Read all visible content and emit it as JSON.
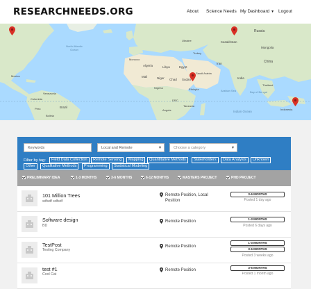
{
  "header": {
    "logo": "RESEARCHNEEDS.ORG",
    "nav": [
      {
        "label": "About"
      },
      {
        "label": "Science Needs"
      },
      {
        "label": "My Dashboard"
      },
      {
        "label": "Logout"
      }
    ]
  },
  "map": {
    "labels": {
      "north_atlantic": "North Atlantic Ocean",
      "mexico": "Mexico",
      "venezuela": "Venezuela",
      "colombia": "Colombia",
      "peru": "Peru",
      "brazil": "Brazil",
      "bolivia": "Bolivia",
      "morocco": "Morocco",
      "algeria": "Algeria",
      "libya": "Libya",
      "egypt": "Egypt",
      "mali": "Mali",
      "niger": "Niger",
      "chad": "Chad",
      "sudan": "Sudan",
      "nigeria": "Nigeria",
      "ethiopia": "Ethiopia",
      "drc": "DRC",
      "tanzania": "Tanzania",
      "angola": "Angola",
      "saudi_arabia": "Saudi Arabia",
      "iran": "Iran",
      "turkey": "Turkey",
      "india": "India",
      "china": "China",
      "kazakhstan": "Kazakhstan",
      "mongolia": "Mongolia",
      "russia": "Russia",
      "indonesia": "Indonesia",
      "thailand": "Thailand",
      "ukraine": "Ukraine",
      "arabian_sea": "Arabian Sea",
      "bay_of_bengal": "Bay of Bengal",
      "indian_ocean": "Indian Ocean"
    }
  },
  "search": {
    "keywords_placeholder": "Keywords",
    "location_value": "Local and Remote",
    "category_placeholder": "Choose a category"
  },
  "filter": {
    "label": "Filter by tag:",
    "tags": [
      "Field Data Collection",
      "Remote Sensing",
      "Mapping",
      "Quantitative Methods",
      "Stakeholders",
      "Data Analysis",
      "Unknown",
      "Other",
      "Qualitative Methods",
      "Programming",
      "Statistical Modeling"
    ]
  },
  "categories": [
    "PRELIMINARY IDEA",
    "1-3 MONTHS",
    "3-6 MONTHS",
    "6-12 MONTHS",
    "MASTERS PROJECT",
    "PHD PROJECT"
  ],
  "items": [
    {
      "title": "101 Million Trees",
      "subtitle": "sdfsdf sdfsdf",
      "location": "Remote Position, Local Position",
      "badges": [
        "3-6 MONTHS"
      ],
      "posted": "Posted 1 day ago"
    },
    {
      "title": "Software design",
      "subtitle": "BD",
      "location": "Remote Position",
      "badges": [
        "1-3 MONTHS"
      ],
      "posted": "Posted 6 days ago"
    },
    {
      "title": "TestPost",
      "subtitle": "Testing Company",
      "location": "Remote Position",
      "badges": [
        "1-3 MONTHS",
        "3-6 MONTHS"
      ],
      "posted": "Posted 3 weeks ago"
    },
    {
      "title": "test #1",
      "subtitle": "Cool Cat",
      "location": "Remote Position",
      "badges": [
        "3-6 MONTHS"
      ],
      "posted": "Posted 1 month ago"
    }
  ],
  "colors": {
    "panel": "#2f7ec4",
    "category_bar": "#a3a3a3",
    "map_water": "#aadaff",
    "map_land": "#d9e8c9",
    "map_desert": "#f1ead4",
    "pin": "#d93025"
  }
}
